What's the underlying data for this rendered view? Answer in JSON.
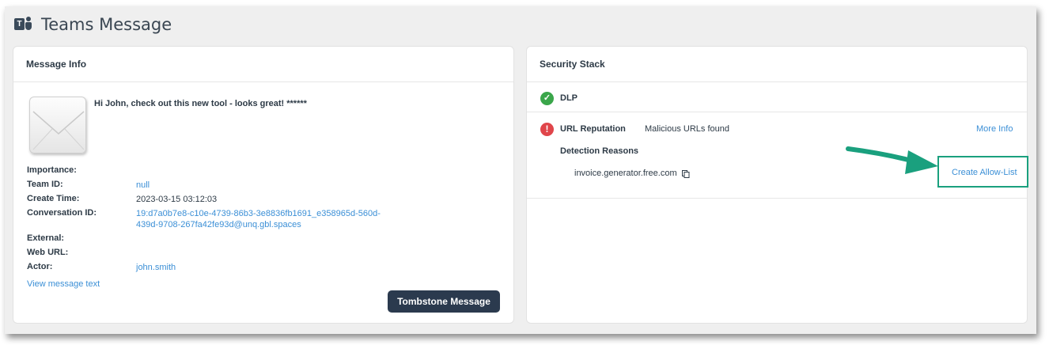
{
  "header": {
    "title": "Teams Message",
    "logo_letter": "T"
  },
  "message_info": {
    "title": "Message Info",
    "subject": "Hi John, check out this new tool - looks great! ******",
    "fields": {
      "importance_label": "Importance:",
      "importance_value": "",
      "team_id_label": "Team ID:",
      "team_id_value": "null",
      "create_time_label": "Create Time:",
      "create_time_value": "2023-03-15 03:12:03",
      "conversation_id_label": "Conversation ID:",
      "conversation_id_line1": "19:d7a0b7e8-c10e-4739-86b3-3e8836fb1691_e358965d-560d-",
      "conversation_id_line2": "439d-9708-267fa42fe93d@unq.gbl.spaces",
      "external_label": "External:",
      "external_value": "",
      "web_url_label": "Web URL:",
      "web_url_value": "",
      "actor_label": "Actor:",
      "actor_value": "john.smith"
    },
    "view_text_link": "View message text",
    "tombstone_button": "Tombstone Message"
  },
  "security_stack": {
    "title": "Security Stack",
    "dlp": {
      "label": "DLP",
      "status": "pass"
    },
    "url_reputation": {
      "label": "URL Reputation",
      "status_text": "Malicious URLs found",
      "more_info": "More Info",
      "detection_reasons_label": "Detection Reasons",
      "domain": "invoice.generator.free.com",
      "allow_list_link": "Create Allow-List"
    }
  },
  "colors": {
    "accent_link": "#3b8fd6",
    "button_dark": "#2b3a4e",
    "success": "#3aa64a",
    "error": "#e0454a",
    "highlight": "#1aa07e"
  },
  "icons": [
    "teams-logo-icon",
    "envelope-icon",
    "check-circle-icon",
    "error-circle-icon",
    "copy-icon",
    "annotation-arrow-icon"
  ]
}
